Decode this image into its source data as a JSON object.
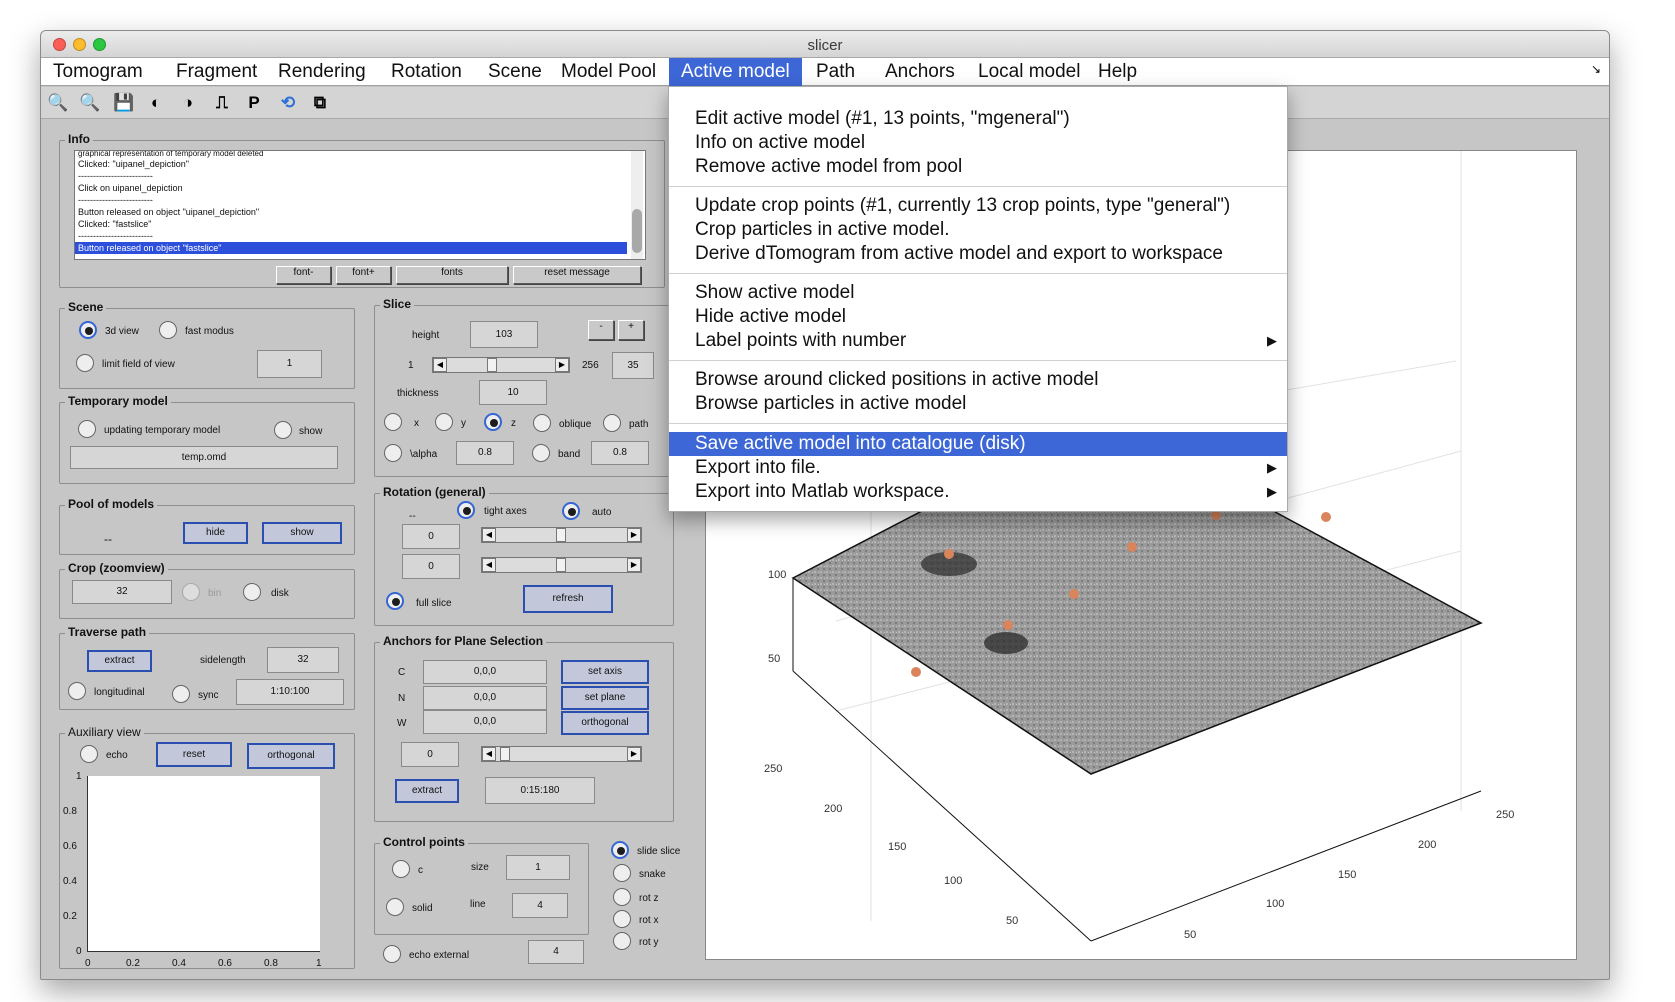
{
  "window": {
    "title": "slicer"
  },
  "menubar": [
    "Tomogram",
    "Fragment",
    "Rendering",
    "Rotation",
    "Scene",
    "Model Pool",
    "Active model",
    "Path",
    "Anchors",
    "Local model",
    "Help"
  ],
  "menu_corner": "↘",
  "toolbar_icons": [
    "zoom-in-icon",
    "zoom-out-icon",
    "save-icon",
    "contrast-icon",
    "contrast2-icon",
    "step-icon",
    "p-icon",
    "rotate-icon",
    "copy-icon"
  ],
  "toolbar_glyphs": [
    "🔍",
    "🔍",
    "💾",
    "◐",
    "◑",
    "⎍",
    "P",
    "⟲",
    "⧉"
  ],
  "info": {
    "title": "Info",
    "log": [
      "graphical representation of temporary model deleted",
      "Clicked: \"uipanel_depiction\"",
      "-------------------------",
      "Click on uipanel_depiction",
      "-------------------------",
      "Button released on object \"uipanel_depiction\"",
      "Clicked: \"fastslice\"",
      "-------------------------",
      "Button released on object \"fastslice\""
    ],
    "buttons": [
      "font-",
      "font+",
      "fonts",
      "reset message"
    ]
  },
  "scene": {
    "title": "Scene",
    "view3d": "3d view",
    "fast": "fast modus",
    "limit": "limit field of view",
    "limit_val": "1"
  },
  "temp": {
    "title": "Temporary model",
    "updating": "updating temporary model",
    "show": "show",
    "file": "temp.omd"
  },
  "pool": {
    "title": "Pool of models",
    "dash": "--",
    "hide": "hide",
    "show": "show"
  },
  "crop": {
    "title": "Crop (zoomview)",
    "val": "32",
    "bin": "bin",
    "disk": "disk"
  },
  "traverse": {
    "title": "Traverse path",
    "extract": "extract",
    "sidelength": "sidelength",
    "side_val": "32",
    "longitudinal": "longitudinal",
    "sync": "sync",
    "range": "1:10:100"
  },
  "aux": {
    "title": "Auxiliary view",
    "echo": "echo",
    "reset": "reset",
    "orthogonal": "orthogonal",
    "yticks": [
      "1",
      "0.8",
      "0.6",
      "0.4",
      "0.2",
      "0"
    ],
    "xticks": [
      "0",
      "0.2",
      "0.4",
      "0.6",
      "0.8",
      "1"
    ]
  },
  "slice": {
    "title": "Slice",
    "height": "height",
    "height_val": "103",
    "minus": "-",
    "plus": "+",
    "min": "1",
    "max": "256",
    "cur": "35",
    "thickness": "thickness",
    "thick_val": "10",
    "x": "x",
    "y": "y",
    "z": "z",
    "oblique": "oblique",
    "path": "path",
    "alpha": "\\alpha",
    "alpha_val": "0.8",
    "band": "band",
    "band_val": "0.8"
  },
  "rotation": {
    "title": "Rotation (general)",
    "dash": "--",
    "tight": "tight axes",
    "auto": "auto",
    "v1": "0",
    "v2": "0",
    "full": "full slice",
    "refresh": "refresh"
  },
  "anchors": {
    "title": "Anchors for Plane Selection",
    "c": "C",
    "n": "N",
    "w": "W",
    "cv": "0,0,0",
    "nv": "0,0,0",
    "wv": "0,0,0",
    "set_axis": "set axis",
    "set_plane": "set plane",
    "orth": "orthogonal",
    "v": "0",
    "extract": "extract",
    "range": "0:15:180"
  },
  "control": {
    "title": "Control points",
    "c": "c",
    "size": "size",
    "size_val": "1",
    "solid": "solid",
    "line": "line",
    "line_val": "4",
    "echo_ext": "echo external",
    "ext_val": "4"
  },
  "modes": [
    "slide slice",
    "snake",
    "rot z",
    "rot x",
    "rot y"
  ],
  "dropdown": {
    "g1": [
      "Edit active model (#1, 13 points, \"mgeneral\")",
      "Info on active model",
      "Remove active model from pool"
    ],
    "g2": [
      "Update crop points (#1, currently 13 crop points, type \"general\")",
      "Crop particles in active model.",
      "Derive dTomogram from active model and export to workspace"
    ],
    "g3": [
      "Show active model",
      "Hide active model",
      "Label points with number"
    ],
    "g4": [
      "Browse around clicked positions in active model",
      "Browse particles in active model"
    ],
    "g5": [
      "Save active model into catalogue (disk)",
      "Export into file.",
      "Export into Matlab workspace."
    ],
    "arrow": "▶"
  },
  "axes3d": {
    "z_ticks": [
      "100",
      "50"
    ],
    "y_ticks": [
      "250",
      "200",
      "150",
      "100",
      "50"
    ],
    "x_ticks": [
      "50",
      "100",
      "150",
      "200",
      "250"
    ],
    "point_color": "#d9845b"
  }
}
